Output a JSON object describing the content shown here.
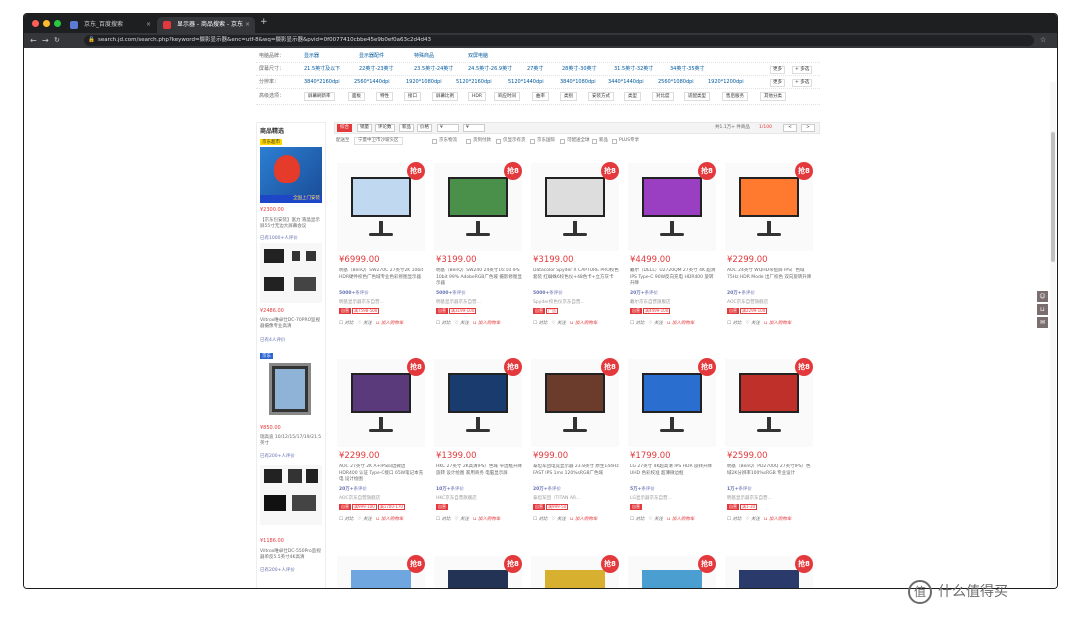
{
  "browser": {
    "tabs": [
      {
        "label": "京东_百度搜索",
        "active": false,
        "color": "#5b7bd5"
      },
      {
        "label": "显示器 - 商品搜索 - 京东",
        "active": true,
        "color": "#e4393c"
      }
    ],
    "new_tab": "+",
    "url": "search.jd.com/search.php?keyword=摄影显示器&enc=utf-8&wq=摄影显示器&pvid=0f0077410cbbe45e9b0ef0a63c2d4d43"
  },
  "filters": [
    {
      "label": "电脑品牌：",
      "options": [
        "显示器",
        "显示器配件",
        "特殊商品",
        "双屏电脑"
      ],
      "more": "",
      "multi": ""
    },
    {
      "label": "屏幕尺寸：",
      "options": [
        "21.5英寸及以下",
        "22英寸-23英寸",
        "23.5英寸-24英寸",
        "24.5英寸-26.9英寸",
        "27英寸",
        "28英寸-30英寸",
        "31.5英寸-32英寸",
        "34英寸-35英寸"
      ],
      "more": "更多",
      "multi": "+ 多选"
    },
    {
      "label": "分辨率：",
      "options": [
        "3840*2160dpi",
        "2560*1440dpi",
        "1920*1080dpi",
        "5120*2160dpi",
        "5120*1440dpi",
        "3840*1080dpi",
        "3440*1440dpi",
        "2560*1080dpi",
        "1920*1200dpi"
      ],
      "more": "更多",
      "multi": "+ 多选"
    }
  ],
  "dropdowns": {
    "label": "高级选项：",
    "items": [
      "屏幕刷新率",
      "面板",
      "特性",
      "接口",
      "屏幕比例",
      "HDR",
      "响应时间",
      "曲率",
      "类别",
      "安装方式",
      "类型",
      "对比度",
      "适配类型",
      "售后服务",
      "其他分类"
    ]
  },
  "sortbar": {
    "items": [
      "综合",
      "销量",
      "评论数",
      "新品",
      "价格"
    ],
    "price_from": "¥",
    "price_to": "¥",
    "count": "共1.1万+ 件商品",
    "page": "1/100",
    "prev": "<",
    "next": ">"
  },
  "shipbar": {
    "label": "配送至",
    "location": "宁夏中卫市沙坡头区",
    "options": [
      "京东物流",
      "货到付款",
      "仅显示有货",
      "京东国际",
      "可配送全球",
      "新品",
      "PLUS专享"
    ]
  },
  "left": {
    "title": "商品精选",
    "ad_label": "京东超市",
    "products": [
      {
        "price": "¥2300.00",
        "name": "【京东包安装】富力 液晶显示屏55寸无边大屏幕会议",
        "comments": "已有1000+人评价",
        "banner": "全国上门安装",
        "top": "130"
      },
      {
        "price": "¥2486.00",
        "name": "Viltrox唯卓仕DC-70PRO监视器摄像专业高清",
        "comments": "已有4人评价",
        "top": "248"
      },
      {
        "price": "¥850.00",
        "name": "瑞高迪 10/12/15/17/19/21.5英寸",
        "comments": "已有200+人评价",
        "top": "365"
      },
      {
        "price": "¥1186.00",
        "name": "Viltrox唯卓仕DC-550Pro监视器单反5.5英寸4K高清",
        "comments": "已有200+人评价",
        "top": "484"
      }
    ]
  },
  "products": [
    {
      "price": "¥6999.00",
      "name": "明基（BenQ）SW270C 27英寸2K 10bit HDR硬件校色广色域专业色彩修图显示器",
      "comments": "5000+",
      "shop": "明基显示器京东自营...",
      "tags": [
        "自营",
        "满7598-500"
      ],
      "color": "#c0d9f0"
    },
    {
      "price": "¥3199.00",
      "name": "明基（BenQ）SW240 24英寸16:10 IPS 10bit 99% AdobeRGB广色域 摄影修图显示器",
      "comments": "5000+",
      "shop": "明基显示器京东自营...",
      "tags": [
        "自营",
        "满3199-100"
      ],
      "color": "#4a8f4a"
    },
    {
      "price": "¥3199.00",
      "name": "Datacolor Spyder X CAPTURE PRO校色套装 红蜘蛛6校色仪+48色卡+立方灰卡",
      "comments": "5000+",
      "shop": "Spyder校色仪京东自营...",
      "tags": [
        "自营",
        "广告"
      ],
      "color": "#ddd"
    },
    {
      "price": "¥4499.00",
      "name": "戴尔（DELL）U2720QM 27英寸 4K 超清 IPS Type-C 90W反向充电 HDR400 旋转升降",
      "comments": "20万+",
      "shop": "戴尔京东自营旗舰店",
      "tags": [
        "自营",
        "满4499-100"
      ],
      "color": "#9a3fc2"
    },
    {
      "price": "¥2299.00",
      "name": "AOC 24英寸 WQHD带鱼屏 IPS广色域 75Hz HDR Mode 出厂校色 双向旋转升降",
      "comments": "20万+",
      "shop": "AOC京东自营旗舰店",
      "tags": [
        "自营",
        "满2299-100"
      ],
      "color": "#ff7a2f"
    },
    {
      "price": "¥2299.00",
      "name": "AOC 27英寸 2K A+IPS四边微边 HDR400 认证 Type-C接口 65W笔记本充电 设计绘图",
      "comments": "20万+",
      "shop": "AOC京东自营旗舰店",
      "tags": [
        "自营",
        "满999-100",
        "满1700-170"
      ],
      "color": "#5a3a7a"
    },
    {
      "price": "¥1399.00",
      "name": "HKC 27英寸 2K高清IPS广色域 窄边框升降旋转 设计绘图 家用商务 电脑显示屏",
      "comments": "10万+",
      "shop": "HKC京东自营旗舰店",
      "tags": [
        "自营"
      ],
      "color": "#1a3b6e"
    },
    {
      "price": "¥999.00",
      "name": "泰坦军团电竞显示器 23.8英寸 原生144Hz FAST IPS 1ms 120%sRGB广色域",
      "comments": "20万+",
      "shop": "泰坦军团（TITAN AR...",
      "tags": [
        "自营",
        "满999-50"
      ],
      "color": "#6b3b2b"
    },
    {
      "price": "¥1799.00",
      "name": "LG 27英寸 4K超高清 IPS HDR 旋转升降 UHD 色彩校准 超薄微边框",
      "comments": "5万+",
      "shop": "LG显示器京东自营...",
      "tags": [
        "自营"
      ],
      "color": "#2a6fd0"
    },
    {
      "price": "¥2599.00",
      "name": "明基（BenQ）PD2700Q 27英寸IPS广色域2K分辨率100%sRGB 专业设计",
      "comments": "1万+",
      "shop": "明基显示器京东自营...",
      "tags": [
        "自营",
        "满1-30"
      ],
      "color": "#c0302a"
    }
  ],
  "ops": {
    "compare": "对比",
    "follow": "关注",
    "cart": "加入购物车"
  },
  "badge": "抢8",
  "watermark": "什么值得买"
}
